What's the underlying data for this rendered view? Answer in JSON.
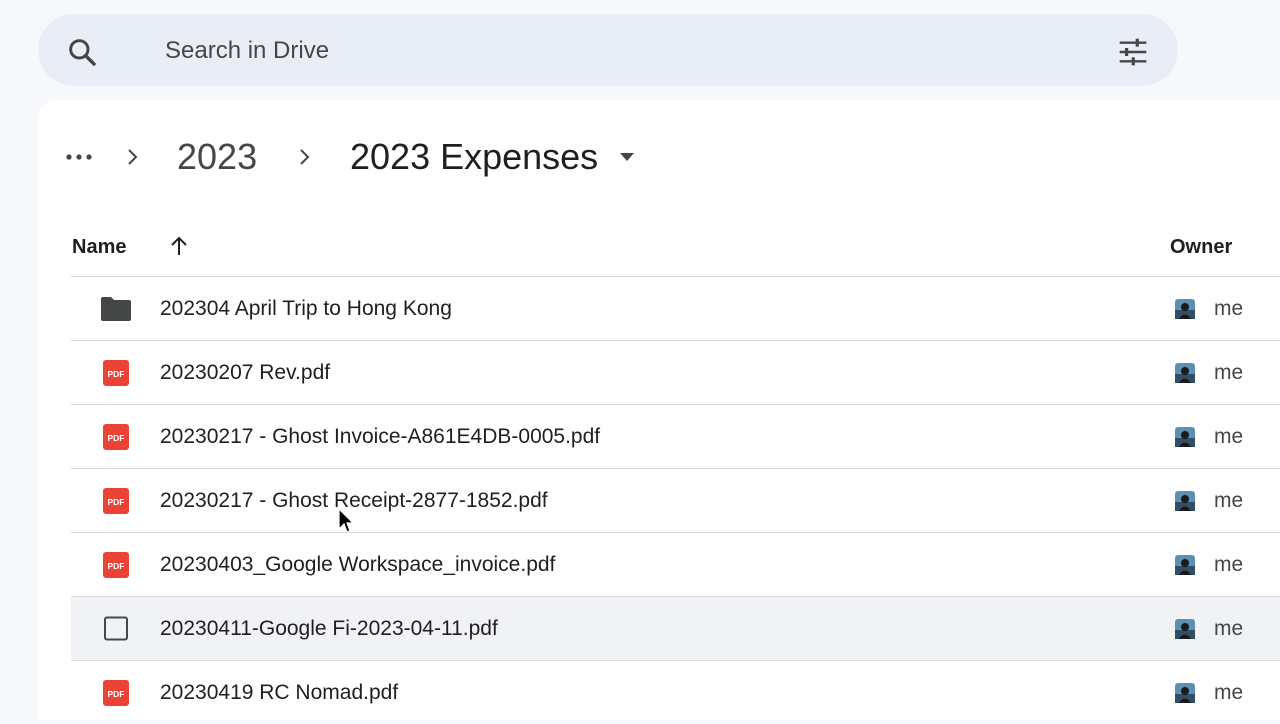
{
  "search": {
    "placeholder": "Search in Drive",
    "search_icon": "search-icon",
    "filter_icon": "tune-icon"
  },
  "breadcrumb": {
    "more_icon": "more-horizontal-icon",
    "items": [
      {
        "label": "2023"
      },
      {
        "label": "2023 Expenses"
      }
    ]
  },
  "columns": {
    "name": "Name",
    "owner": "Owner",
    "sort_icon": "arrow-up-icon"
  },
  "files": [
    {
      "name": "202304 April Trip to Hong Kong",
      "type": "folder",
      "owner": "me"
    },
    {
      "name": "20230207 Rev.pdf",
      "type": "pdf",
      "owner": "me"
    },
    {
      "name": "20230217 - Ghost Invoice-A861E4DB-0005.pdf",
      "type": "pdf",
      "owner": "me"
    },
    {
      "name": "20230217 - Ghost Receipt-2877-1852.pdf",
      "type": "pdf",
      "owner": "me"
    },
    {
      "name": "20230403_Google Workspace_invoice.pdf",
      "type": "pdf",
      "owner": "me"
    },
    {
      "name": "20230411-Google Fi-2023-04-11.pdf",
      "type": "checkbox",
      "owner": "me",
      "hovered": true
    },
    {
      "name": "20230419 RC Nomad.pdf",
      "type": "pdf",
      "owner": "me"
    }
  ],
  "pdf_badge": "PDF",
  "colors": {
    "pdf_red": "#ea4335",
    "folder_gray": "#444746",
    "search_bg": "#e9eef6",
    "page_bg": "#f6f8fb"
  }
}
